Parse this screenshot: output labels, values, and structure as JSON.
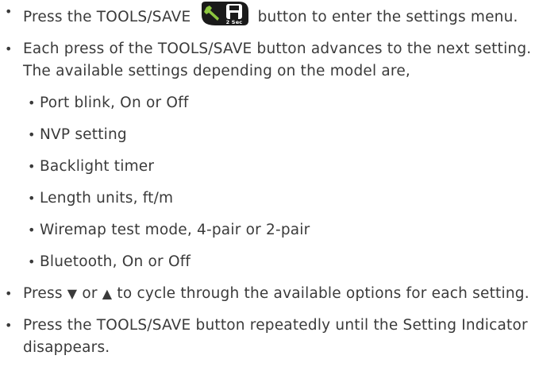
{
  "items": [
    {
      "text_before": "Press the TOOLS/SAVE ",
      "icon_label": "2 Sec",
      "text_after": " button to enter the settings menu."
    },
    {
      "text": "Each press of the TOOLS/SAVE button advances to the next setting. The available settings depending on the model are,",
      "subitems": [
        "Port blink, On or Off",
        "NVP setting",
        "Backlight timer",
        "Length units, ft/m",
        "Wiremap test mode, 4-pair or 2-pair",
        "Bluetooth, On or Off"
      ]
    },
    {
      "text_press": "Press ",
      "down_glyph": "▼",
      "text_or": " or ",
      "up_glyph": "▲",
      "text_rest": " to cycle through the available options for each setting."
    },
    {
      "text": "Press the TOOLS/SAVE button repeatedly until the Setting Indicator disappears."
    }
  ],
  "bullet": "•",
  "colors": {
    "text": "#3a3a3a",
    "icon_bg": "#1a1a1a",
    "icon_accent": "#8dc63f"
  }
}
